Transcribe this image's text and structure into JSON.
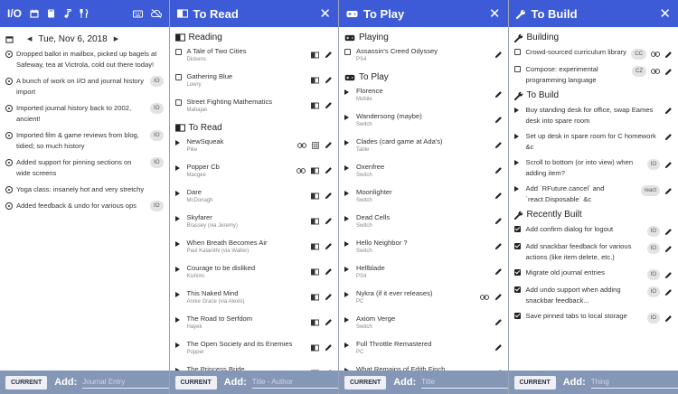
{
  "journal": {
    "app_title": "I/O",
    "date": "Tue, Nov 6, 2018",
    "entries": [
      {
        "text": "Dropped ballot in mailbox, picked up bagels at Safeway, tea at Victrola, cold out there today!",
        "tag": ""
      },
      {
        "text": "A bunch of work on I/O and journal history import",
        "tag": "IO"
      },
      {
        "text": "Imported journal history back to 2002, ancient!",
        "tag": "IO"
      },
      {
        "text": "Imported film & game reviews from blog, tidied; so much history",
        "tag": "IO"
      },
      {
        "text": "Added support for pinning sections on wide screens",
        "tag": "IO"
      },
      {
        "text": "Yoga class: insanely hot and very stretchy",
        "tag": ""
      },
      {
        "text": "Added feedback & undo for various ops",
        "tag": "IO"
      }
    ],
    "current_label": "CURRENT",
    "add_label": "Add:",
    "placeholder": "Journal Entry"
  },
  "read": {
    "title": "To Read",
    "reading_heading": "Reading",
    "reading": [
      {
        "name": "A Tale of Two Cities",
        "author": "Dickens"
      },
      {
        "name": "Gathering Blue",
        "author": "Lowry"
      },
      {
        "name": "Street Fighting Mathematics",
        "author": "Mahajan"
      }
    ],
    "toread_heading": "To Read",
    "toread": [
      {
        "name": "NewSqueak",
        "author": "Pike",
        "link": true,
        "grid": true
      },
      {
        "name": "Popper Cb",
        "author": "Macgee",
        "link": true,
        "book": true
      },
      {
        "name": "Dare",
        "author": "McDonagh",
        "book": true
      },
      {
        "name": "Skyfarer",
        "author": "Brassey (via Jeremy)",
        "book": true
      },
      {
        "name": "When Breath Becomes Air",
        "author": "Paul Kalanithi (via Walter)",
        "book": true
      },
      {
        "name": "Courage to be disliked",
        "author": "Kishimi",
        "book": true
      },
      {
        "name": "This Naked Mind",
        "author": "Annie Grace (via Alexis)",
        "book": true
      },
      {
        "name": "The Road to Serfdom",
        "author": "Hayek",
        "book": true
      },
      {
        "name": "The Open Society and its Enemies",
        "author": "Popper",
        "book": true
      },
      {
        "name": "The Princess Bride",
        "author": "",
        "book": true
      }
    ],
    "current_label": "CURRENT",
    "add_label": "Add:",
    "placeholder": "Title - Author"
  },
  "play": {
    "title": "To Play",
    "playing_heading": "Playing",
    "playing": [
      {
        "name": "Assassin's Creed Odyssey",
        "platform": "PS4"
      }
    ],
    "toplay_heading": "To Play",
    "toplay": [
      {
        "name": "Florence",
        "platform": "Mobile"
      },
      {
        "name": "Wandersong (maybe)",
        "platform": "Switch"
      },
      {
        "name": "Clades (card game at Ada's)",
        "platform": "Table"
      },
      {
        "name": "Oxenfree",
        "platform": "Switch"
      },
      {
        "name": "Moonlighter",
        "platform": "Switch"
      },
      {
        "name": "Dead Cells",
        "platform": "Switch"
      },
      {
        "name": "Hello Neighbor ?",
        "platform": "Switch"
      },
      {
        "name": "Hellblade",
        "platform": "PS4"
      },
      {
        "name": "Nykra (if it ever releases)",
        "platform": "PC",
        "link": true
      },
      {
        "name": "Axiom Verge",
        "platform": "Switch"
      },
      {
        "name": "Full Throttle Remastered",
        "platform": "PC"
      },
      {
        "name": "What Remains of Edith Finch",
        "platform": ""
      }
    ],
    "current_label": "CURRENT",
    "add_label": "Add:",
    "placeholder": "Title"
  },
  "build": {
    "title": "To Build",
    "building_heading": "Building",
    "building": [
      {
        "name": "Crowd-sourced curriculum library",
        "tag": "CC",
        "link": true
      },
      {
        "name": "Compose: experimental programming language",
        "tag": "CZ",
        "link": true
      }
    ],
    "tobuild_heading": "To Build",
    "tobuild": [
      {
        "name": "Buy standing desk for office, swap Eames desk into spare room",
        "tag": ""
      },
      {
        "name": "Set up desk in spare room for C homework &c",
        "tag": ""
      },
      {
        "name": "Scroll to bottom (or into view) when adding item?",
        "tag": "IO"
      },
      {
        "name": "Add `RFuture.cancel` and `react.Disposable` &c",
        "tag": "react"
      }
    ],
    "built_heading": "Recently Built",
    "built": [
      {
        "name": "Add confirm dialog for logout",
        "tag": "IO"
      },
      {
        "name": "Add snackbar feedback for various actions (like item delete, etc.)",
        "tag": "IO"
      },
      {
        "name": "Migrate old journal entries",
        "tag": "IO"
      },
      {
        "name": "Add undo support when adding snackbar feedback...",
        "tag": "IO"
      },
      {
        "name": "Save pinned tabs to local storage",
        "tag": "IO"
      }
    ],
    "current_label": "CURRENT",
    "add_label": "Add:",
    "placeholder": "Thing"
  },
  "colors": {
    "accent": "#3d5bd6",
    "footer": "#8597b6"
  }
}
